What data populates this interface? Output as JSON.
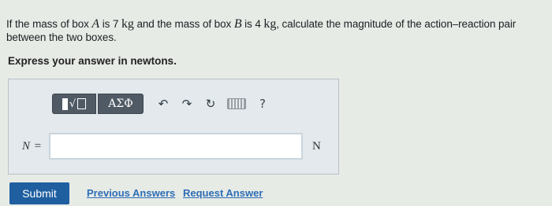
{
  "question": {
    "p1": "If the mass of box ",
    "var_a": "A",
    "p2": " is 7 ",
    "unit1": "kg",
    "p3": " and the mass of box ",
    "var_b": "B",
    "p4": " is 4 ",
    "unit2": "kg",
    "p5": ", calculate the magnitude of the action–reaction pair between the two boxes."
  },
  "instruction": "Express your answer in newtons.",
  "toolbar": {
    "radical_glyph": "√",
    "greek_label": "ΑΣΦ",
    "undo_glyph": "↶",
    "redo_glyph": "↷",
    "reset_glyph": "↻",
    "help_label": "?"
  },
  "answer": {
    "variable": "N",
    "equals": " =",
    "value": "",
    "unit": "N"
  },
  "actions": {
    "submit_label": "Submit",
    "previous_answers_label": "Previous Answers",
    "request_answer_label": "Request Answer"
  }
}
